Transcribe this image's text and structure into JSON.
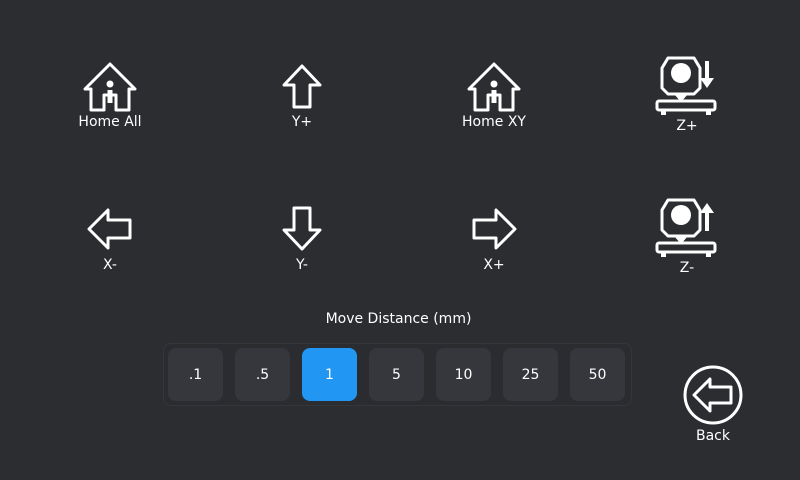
{
  "jog": {
    "home_all": "Home All",
    "y_plus": "Y+",
    "home_xy": "Home XY",
    "z_plus": "Z+",
    "x_minus": "X-",
    "y_minus": "Y-",
    "x_plus": "X+",
    "z_minus": "Z-"
  },
  "distance": {
    "title": "Move Distance (mm)",
    "options": [
      ".1",
      ".5",
      "1",
      "5",
      "10",
      "25",
      "50"
    ],
    "selected": "1"
  },
  "back": {
    "label": "Back"
  },
  "colors": {
    "background": "#2b2d31",
    "button": "#35373c",
    "accent": "#2196f3",
    "text": "#ffffff"
  },
  "icons": {
    "home_all": "home-icon",
    "y_plus": "arrow-up-icon",
    "home_xy": "home-icon",
    "z_plus": "bed-down-icon",
    "x_minus": "arrow-left-icon",
    "y_minus": "arrow-down-icon",
    "x_plus": "arrow-right-icon",
    "z_minus": "bed-up-icon",
    "back": "back-circle-icon"
  }
}
